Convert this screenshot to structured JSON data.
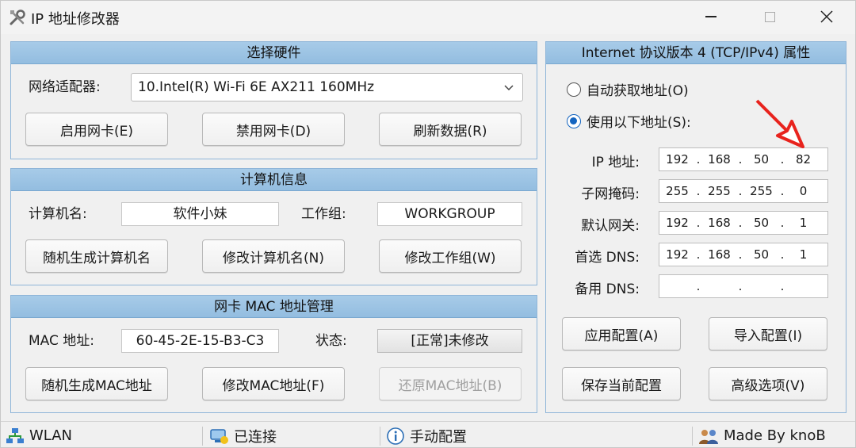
{
  "window": {
    "title": "IP 地址修改器"
  },
  "hardware": {
    "header": "选择硬件",
    "adapter_label": "网络适配器:",
    "adapter_value": "10.Intel(R) Wi-Fi 6E AX211 160MHz",
    "buttons": [
      "启用网卡(E)",
      "禁用网卡(D)",
      "刷新数据(R)"
    ]
  },
  "computer": {
    "header": "计算机信息",
    "name_label": "计算机名:",
    "name_value": "软件小妹",
    "workgroup_label": "工作组:",
    "workgroup_value": "WORKGROUP",
    "buttons": [
      "随机生成计算机名",
      "修改计算机名(N)",
      "修改工作组(W)"
    ]
  },
  "mac": {
    "header": "网卡 MAC 地址管理",
    "mac_label": "MAC 地址:",
    "mac_value": "60-45-2E-15-B3-C3",
    "status_label": "状态:",
    "status_value": "[正常]未修改",
    "buttons": [
      "随机生成MAC地址",
      "修改MAC地址(F)",
      "还原MAC地址(B)"
    ]
  },
  "tcpip": {
    "header": "Internet 协议版本 4 (TCP/IPv4) 属性",
    "radio_auto": "自动获取地址(O)",
    "radio_manual": "使用以下地址(S):",
    "ip_label": "IP 地址:",
    "ip": [
      "192",
      "168",
      "50",
      "82"
    ],
    "mask_label": "子网掩码:",
    "mask": [
      "255",
      "255",
      "255",
      "0"
    ],
    "gateway_label": "默认网关:",
    "gateway": [
      "192",
      "168",
      "50",
      "1"
    ],
    "dns1_label": "首选 DNS:",
    "dns1": [
      "192",
      "168",
      "50",
      "1"
    ],
    "dns2_label": "备用 DNS:",
    "dns2": [
      "",
      "",
      "",
      ""
    ],
    "buttons": [
      "应用配置(A)",
      "导入配置(I)",
      "保存当前配置",
      "高级选项(V)"
    ]
  },
  "statusbar": {
    "network": "WLAN",
    "connection": "已连接",
    "mode": "手动配置",
    "author": "Made By knoB"
  },
  "colors": {
    "accent_blue": "#1565c0",
    "header_blue": "#a7cbe8",
    "arrow_red": "#e8231d"
  },
  "icons": [
    "tools-icon",
    "minimize-icon",
    "maximize-icon",
    "close-icon",
    "chevron-down-icon",
    "network-icon",
    "connected-icon",
    "info-icon",
    "users-icon",
    "arrow-icon"
  ]
}
